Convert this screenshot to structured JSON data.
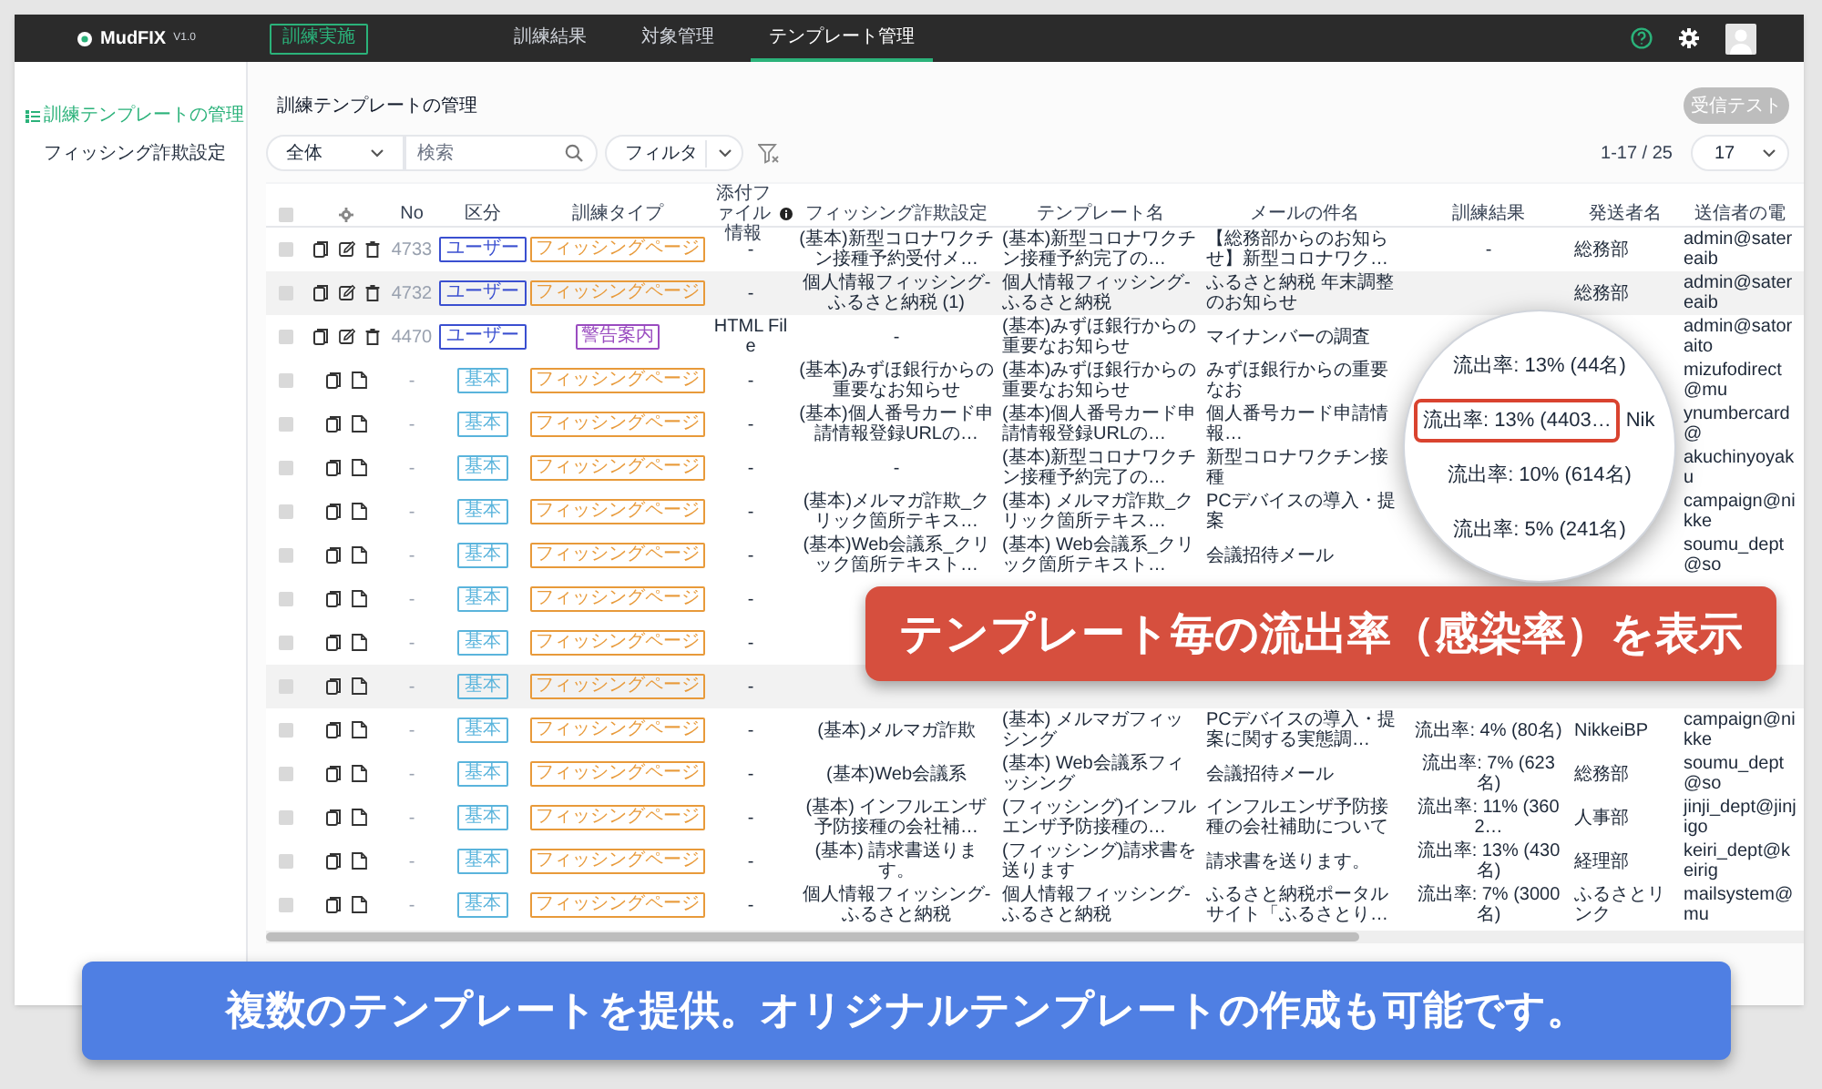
{
  "header": {
    "logo": "MudFIX",
    "version": "V1.0",
    "action_button": "訓練実施",
    "nav": [
      {
        "label": "訓練結果",
        "selected": false
      },
      {
        "label": "対象管理",
        "selected": false
      },
      {
        "label": "テンプレート管理",
        "selected": true
      }
    ]
  },
  "sidebar": {
    "items": [
      {
        "label": "訓練テンプレートの管理",
        "selected": true
      },
      {
        "label": "フィッシング詐欺設定",
        "selected": false
      }
    ]
  },
  "page": {
    "title": "訓練テンプレートの管理",
    "test_button": {
      "label": "受信テスト",
      "disabled": true
    }
  },
  "toolbar": {
    "scope": "全体",
    "search_placeholder": "検索",
    "filter": "フィルタ",
    "range": "1-17 / 25",
    "page_size": "17"
  },
  "table": {
    "select_all_checked": false,
    "columns": [
      "No",
      "区分",
      "訓練タイプ",
      "添付ファイル情報",
      "フィッシング詐欺設定",
      "テンプレート名",
      "メールの件名",
      "訓練結果",
      "発送者名",
      "送信者の電"
    ],
    "rows": [
      {
        "kind": "user",
        "checked": false,
        "hovered": false,
        "no": "4733",
        "category": "ユーザー",
        "type": {
          "label": "フィッシングページ",
          "color": "#e89a3a"
        },
        "attachment": "-",
        "phishing_setting": "(基本)新型コロナワクチン接種予約受付メ…",
        "template": "(基本)新型コロナワクチン接種予約完了の…",
        "subject": "【総務部からのお知らせ】新型コロナワク…",
        "result": "-",
        "sender": "総務部",
        "email": "admin@satereaib"
      },
      {
        "kind": "user",
        "checked": false,
        "hovered": true,
        "no": "4732",
        "category": "ユーザー",
        "type": {
          "label": "フィッシングページ",
          "color": "#e89a3a"
        },
        "attachment": "-",
        "phishing_setting": "個人情報フィッシング-ふるさと納税 (1)",
        "template": "個人情報フィッシング-ふるさと納税",
        "subject": "ふるさと納税 年末調整のお知らせ",
        "sender": "総務部",
        "email": "admin@satereaib"
      },
      {
        "kind": "user",
        "checked": false,
        "hovered": false,
        "no": "4470",
        "category": "ユーザー",
        "type": {
          "label": "警告案内",
          "color": "#9a4cc0"
        },
        "attachment": "HTML File",
        "phishing_setting": "-",
        "template": "(基本)みずほ銀行からの重要なお知らせ",
        "subject": "マイナンバーの調査",
        "email": "admin@satoraito"
      },
      {
        "kind": "basic",
        "checked": false,
        "hovered": false,
        "no": "-",
        "category": "基本",
        "type": {
          "label": "フィッシングページ",
          "color": "#e89a3a"
        },
        "attachment": "-",
        "phishing_setting": "(基本)みずほ銀行からの重要なお知らせ",
        "template": "(基本)みずほ銀行からの重要なお知らせ",
        "subject": "みずほ銀行からの重要なお",
        "email": "mizufodirect@mu"
      },
      {
        "kind": "basic",
        "checked": false,
        "hovered": false,
        "no": "-",
        "category": "基本",
        "type": {
          "label": "フィッシングページ",
          "color": "#e89a3a"
        },
        "attachment": "-",
        "phishing_setting": "(基本)個人番号カード申請情報登録URLの…",
        "template": "(基本)個人番号カード申請情報登録URLの…",
        "subject": "個人番号カード申請情報…",
        "email": "ynumbercard@"
      },
      {
        "kind": "basic",
        "checked": false,
        "hovered": false,
        "no": "-",
        "category": "基本",
        "type": {
          "label": "フィッシングページ",
          "color": "#e89a3a"
        },
        "attachment": "-",
        "phishing_setting": "-",
        "template": "(基本)新型コロナワクチン接種予約完了の…",
        "subject": "新型コロナワクチン接種",
        "email": "akuchinyoyaku"
      },
      {
        "kind": "basic",
        "checked": false,
        "hovered": false,
        "no": "-",
        "category": "基本",
        "type": {
          "label": "フィッシングページ",
          "color": "#e89a3a"
        },
        "attachment": "-",
        "phishing_setting": "(基本)メルマガ詐欺_クリック箇所テキス…",
        "template": "(基本) メルマガ詐欺_クリック箇所テキス…",
        "subject": "PCデバイスの導入・提案",
        "email": "campaign@nikke"
      },
      {
        "kind": "basic",
        "checked": false,
        "hovered": false,
        "no": "-",
        "category": "基本",
        "type": {
          "label": "フィッシングページ",
          "color": "#e89a3a"
        },
        "attachment": "-",
        "phishing_setting": "(基本)Web会議系_クリック箇所テキスト…",
        "template": "(基本) Web会議系_クリック箇所テキスト…",
        "subject": "会議招待メール",
        "email": "soumu_dept@so"
      },
      {
        "kind": "basic",
        "checked": false,
        "hovered": false,
        "no": "-",
        "category": "基本",
        "type": {
          "label": "フィッシングページ",
          "color": "#e89a3a"
        },
        "attachment": "-"
      },
      {
        "kind": "basic",
        "checked": false,
        "hovered": false,
        "no": "-",
        "category": "基本",
        "type": {
          "label": "フィッシングページ",
          "color": "#e89a3a"
        },
        "attachment": "-"
      },
      {
        "kind": "basic",
        "checked": false,
        "hovered": true,
        "no": "-",
        "category": "基本",
        "type": {
          "label": "フィッシングページ",
          "color": "#e89a3a"
        },
        "attachment": "-"
      },
      {
        "kind": "basic",
        "checked": false,
        "hovered": false,
        "no": "-",
        "category": "基本",
        "type": {
          "label": "フィッシングページ",
          "color": "#e89a3a"
        },
        "attachment": "-",
        "phishing_setting": "(基本)メルマガ詐欺",
        "template": "(基本) メルマガフィッシング",
        "subject": "PCデバイスの導入・提案に関する実態調…",
        "result": "流出率: 4% (80名)",
        "sender": "NikkeiBP",
        "email": "campaign@nikke"
      },
      {
        "kind": "basic",
        "checked": false,
        "hovered": false,
        "no": "-",
        "category": "基本",
        "type": {
          "label": "フィッシングページ",
          "color": "#e89a3a"
        },
        "attachment": "-",
        "phishing_setting": "(基本)Web会議系",
        "template": "(基本) Web会議系フィッシング",
        "subject": "会議招待メール",
        "result": "流出率: 7% (623名)",
        "sender": "総務部",
        "email": "soumu_dept@so"
      },
      {
        "kind": "basic",
        "checked": false,
        "hovered": false,
        "no": "-",
        "category": "基本",
        "type": {
          "label": "フィッシングページ",
          "color": "#e89a3a"
        },
        "attachment": "-",
        "phishing_setting": "(基本) インフルエンザ予防接種の会社補…",
        "template": "(フィッシング)インフルエンザ予防接種の…",
        "subject": "インフルエンザ予防接種の会社補助について",
        "result": "流出率: 11% (3602…",
        "sender": "人事部",
        "email": "jinji_dept@jinjigo"
      },
      {
        "kind": "basic",
        "checked": false,
        "hovered": false,
        "no": "-",
        "category": "基本",
        "type": {
          "label": "フィッシングページ",
          "color": "#e89a3a"
        },
        "attachment": "-",
        "phishing_setting": "(基本) 請求書送ります。",
        "template": "(フィッシング)請求書を送ります",
        "subject": "請求書を送ります。",
        "result": "流出率: 13% (430名)",
        "sender": "経理部",
        "email": "keiri_dept@keirig"
      },
      {
        "kind": "basic",
        "checked": false,
        "hovered": false,
        "no": "-",
        "category": "基本",
        "type": {
          "label": "フィッシングページ",
          "color": "#e89a3a"
        },
        "attachment": "-",
        "phishing_setting": "個人情報フィッシング-ふるさと納税",
        "template": "個人情報フィッシング-ふるさと納税",
        "subject": "ふるさと納税ポータルサイト「ふるさとり…",
        "result": "流出率: 7% (3000名)",
        "sender": "ふるさとリンク",
        "email": "mailsystem@mu"
      }
    ]
  },
  "magnifier": {
    "rows": [
      {
        "result": "流出率: 13% (44名)",
        "highlighted": false
      },
      {
        "result": "流出率: 13% (4403…",
        "sender": "Nik",
        "highlighted": true
      },
      {
        "result": "流出率: 10% (614名)",
        "highlighted": false
      },
      {
        "result": "流出率: 5% (241名)",
        "highlighted": false
      }
    ]
  },
  "callouts": [
    {
      "kind": "red",
      "text": "テンプレート毎の流出率（感染率）を表示"
    },
    {
      "kind": "blue",
      "text": "複数のテンプレートを提供。オリジナルテンプレートの作成も可能です。"
    }
  ]
}
